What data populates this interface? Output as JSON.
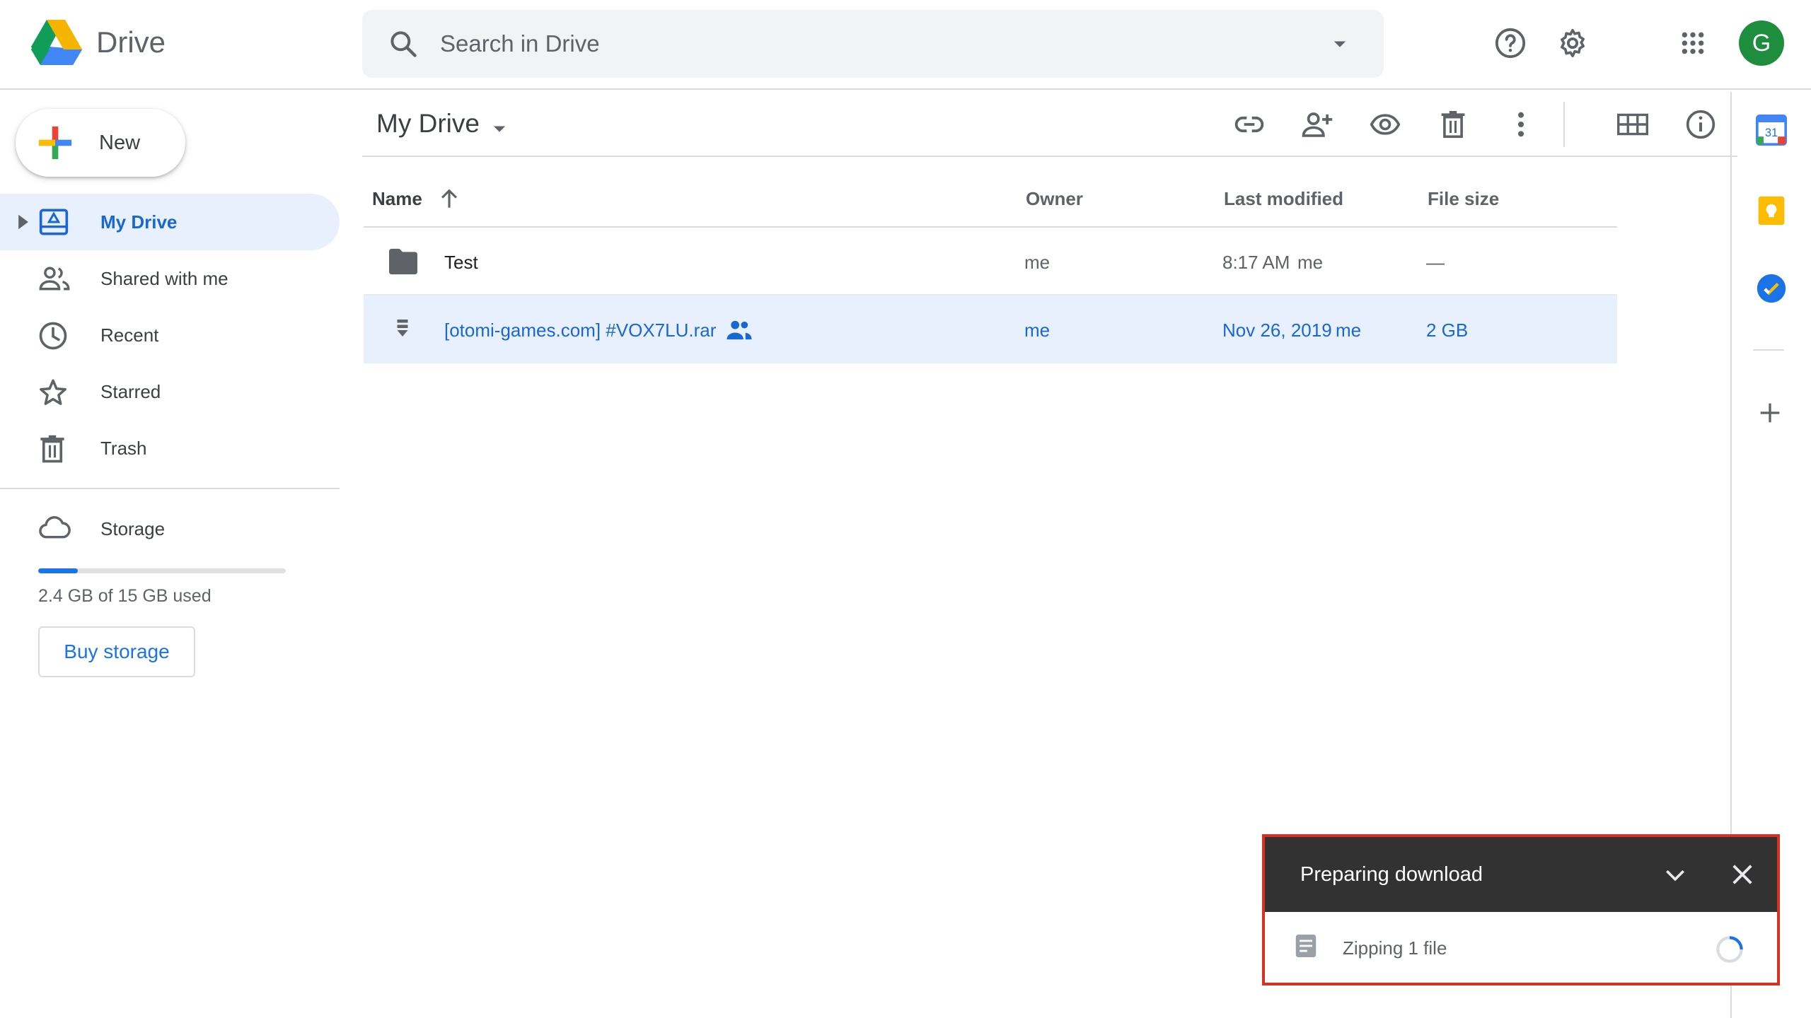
{
  "app": {
    "name": "Drive"
  },
  "search": {
    "placeholder": "Search in Drive"
  },
  "header": {
    "avatar_letter": "G"
  },
  "new_button": {
    "label": "New"
  },
  "sidebar": {
    "items": [
      {
        "label": "My Drive",
        "icon": "my-drive-icon",
        "active": true
      },
      {
        "label": "Shared with me",
        "icon": "people-icon"
      },
      {
        "label": "Recent",
        "icon": "clock-icon"
      },
      {
        "label": "Starred",
        "icon": "star-icon"
      },
      {
        "label": "Trash",
        "icon": "trash-icon"
      }
    ],
    "storage": {
      "label": "Storage",
      "usage_text": "2.4 GB of 15 GB used",
      "used_fraction": 0.16,
      "buy_label": "Buy storage"
    }
  },
  "main": {
    "title": "My Drive",
    "columns": {
      "name": "Name",
      "owner": "Owner",
      "modified": "Last modified",
      "size": "File size"
    },
    "rows": [
      {
        "name": "Test",
        "owner": "me",
        "modified": "8:17 AM",
        "modified_by": "me",
        "size": "—",
        "type": "folder",
        "selected": false
      },
      {
        "name": "[otomi-games.com] #VOX7LU.rar",
        "owner": "me",
        "modified": "Nov 26, 2019",
        "modified_by": "me",
        "size": "2 GB",
        "type": "archive",
        "shared": true,
        "selected": true
      }
    ]
  },
  "side_panel": {
    "calendar_day": "31"
  },
  "download": {
    "title": "Preparing download",
    "status": "Zipping 1 file"
  },
  "colors": {
    "accent": "#1a73e8",
    "selected_row": "#e8f0fe",
    "toast_bg": "#323232",
    "toast_border": "#d93025"
  }
}
